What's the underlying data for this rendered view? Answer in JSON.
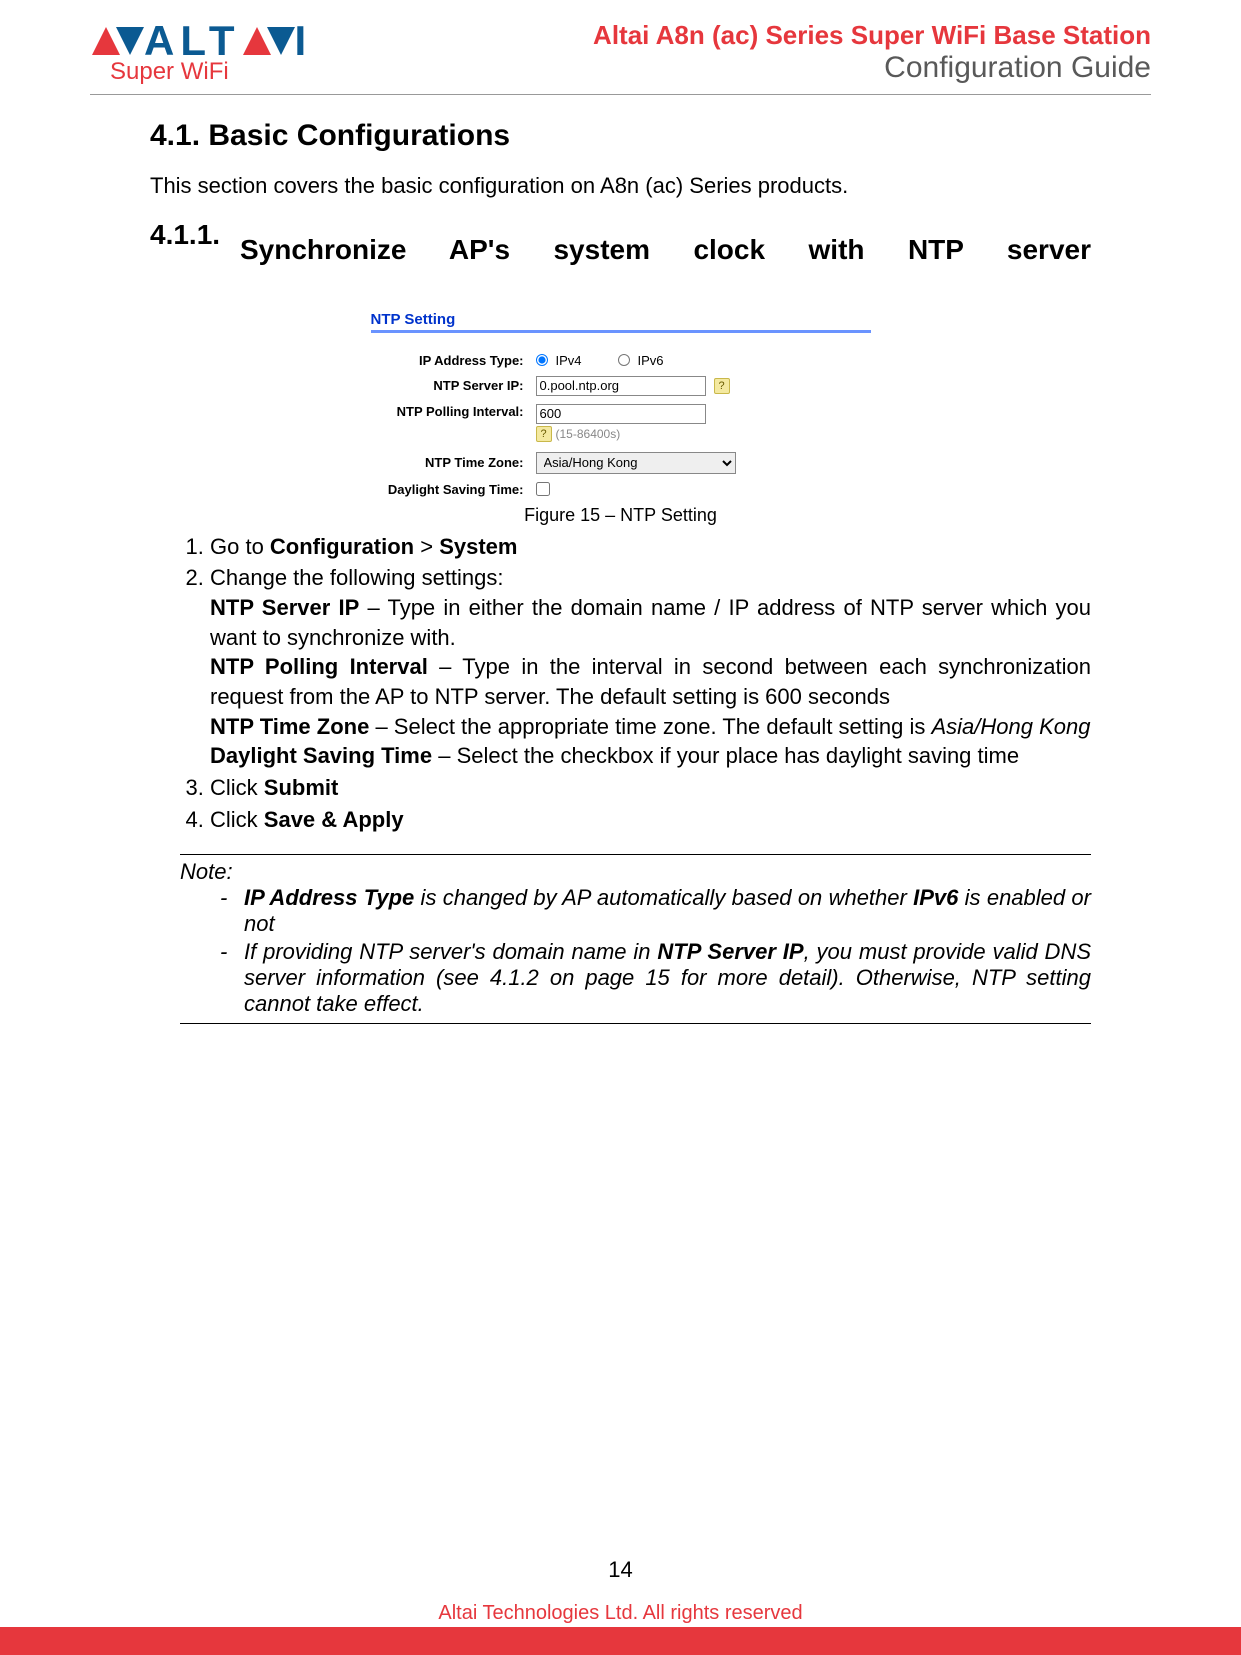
{
  "header": {
    "logo_text_1": "ALT",
    "logo_text_2": "I",
    "logo_subtitle": "Super WiFi",
    "line1": "Altai A8n (ac) Series Super WiFi Base Station",
    "line2": "Configuration Guide"
  },
  "section": {
    "number": "4.1.",
    "title": "Basic Configurations",
    "intro": "This section covers the basic configuration on A8n (ac) Series products."
  },
  "subsection": {
    "number": "4.1.1.",
    "title": "Synchronize AP's system clock with NTP server"
  },
  "figure": {
    "panel_title": "NTP Setting",
    "labels": {
      "ip_type": "IP Address Type:",
      "server_ip": "NTP Server IP:",
      "polling": "NTP Polling Interval:",
      "timezone": "NTP Time Zone:",
      "dst": "Daylight Saving Time:"
    },
    "values": {
      "ip_type_v4": "IPv4",
      "ip_type_v6": "IPv6",
      "server_ip": "0.pool.ntp.org",
      "polling": "600",
      "polling_hint": "(15-86400s)",
      "timezone": "Asia/Hong Kong"
    },
    "caption": "Figure 15 – NTP Setting"
  },
  "steps": {
    "s1_a": "Go to ",
    "s1_b": "Configuration",
    "s1_c": " > ",
    "s1_d": "System",
    "s2": "Change the following settings:",
    "s2_ntp_ip_b": "NTP Server IP",
    "s2_ntp_ip_t": " – Type in either the domain name / IP address of NTP server which you want to synchronize with.",
    "s2_poll_b": "NTP Polling Interval",
    "s2_poll_t": " – Type in the interval in second between each synchronization request from the AP to NTP server. The default setting is 600 seconds",
    "s2_tz_b": "NTP Time Zone",
    "s2_tz_t1": " – Select the appropriate time zone. The default setting is ",
    "s2_tz_i": "Asia/Hong Kong",
    "s2_dst_b": "Daylight Saving Time",
    "s2_dst_t": " – Select the checkbox if your place has daylight saving time",
    "s3_a": "Click ",
    "s3_b": "Submit",
    "s4_a": "Click ",
    "s4_b": "Save & Apply"
  },
  "note": {
    "heading": "Note:",
    "n1_b": "IP Address Type",
    "n1_t1": " is changed by AP automatically based on whether ",
    "n1_b2": "IPv6",
    "n1_t2": " is enabled or not",
    "n2_t1": "If providing NTP server's domain name in ",
    "n2_b": "NTP Server IP",
    "n2_t2": ", you must provide valid DNS server information (see 4.1.2 on page 15 for more detail). Otherwise, NTP setting cannot take effect."
  },
  "footer": {
    "page_number": "14",
    "copyright": "Altai Technologies Ltd. All rights reserved"
  }
}
